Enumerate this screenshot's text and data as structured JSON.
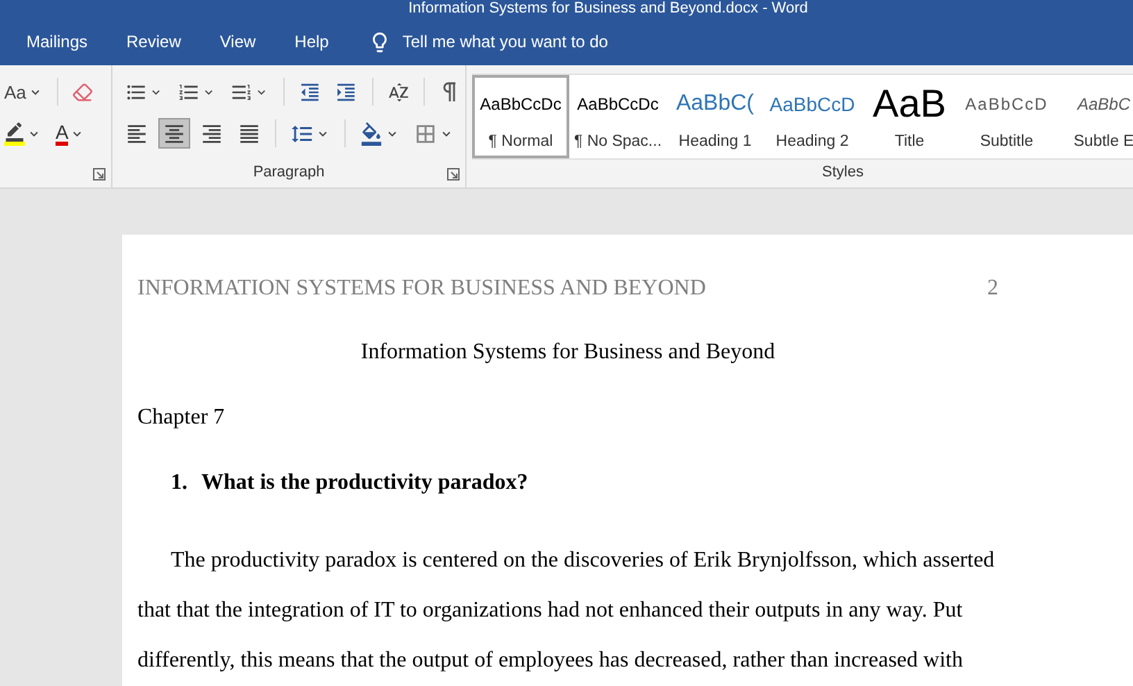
{
  "window": {
    "title": "Information Systems for Business and Beyond.docx  -  Word"
  },
  "menu_tabs": [
    {
      "label": "Mailings",
      "selected": false
    },
    {
      "label": "Review",
      "selected": false
    },
    {
      "label": "View",
      "selected": false
    },
    {
      "label": "Help",
      "selected": false
    }
  ],
  "tell_me": {
    "placeholder": "Tell me what you want to do"
  },
  "font_group": {
    "change_case": "Aa",
    "font_color": "A"
  },
  "paragraph_group": {
    "label": "Paragraph",
    "align_buttons": [
      {
        "kind": "left",
        "selected": false
      },
      {
        "kind": "center",
        "selected": true
      },
      {
        "kind": "right",
        "selected": false
      },
      {
        "kind": "justify",
        "selected": false
      }
    ]
  },
  "styles_group": {
    "label": "Styles",
    "items": [
      {
        "kind": "normal",
        "preview": "AaBbCcDc",
        "name": "¶ Normal",
        "selected": true
      },
      {
        "kind": "normal",
        "preview": "AaBbCcDc",
        "name": "¶ No Spac...",
        "selected": false
      },
      {
        "kind": "heading1",
        "preview": "AaBbC(",
        "name": "Heading 1",
        "selected": false
      },
      {
        "kind": "heading2",
        "preview": "AaBbCcD",
        "name": "Heading 2",
        "selected": false
      },
      {
        "kind": "title",
        "preview": "AaB",
        "name": "Title",
        "selected": false
      },
      {
        "kind": "subtitle",
        "preview": "AaBbCcD",
        "name": "Subtitle",
        "selected": false
      },
      {
        "kind": "subtle",
        "preview": "AaBbC",
        "name": "Subtle E",
        "selected": false
      }
    ]
  },
  "document": {
    "header": {
      "running_head": "INFORMATION SYSTEMS FOR BUSINESS AND BEYOND",
      "page_number": "2"
    },
    "title": "Information Systems for Business and Beyond",
    "chapter": "Chapter 7",
    "question": {
      "number": "1.",
      "text": "What is the productivity paradox?"
    },
    "paragraphs": [
      "The productivity paradox is centered on the discoveries of Erik Brynjolfsson, which asserted that that the integration of IT to organizations had not enhanced their outputs in any way. Put differently, this means that the output of employees has decreased, rather than increased with"
    ]
  }
}
